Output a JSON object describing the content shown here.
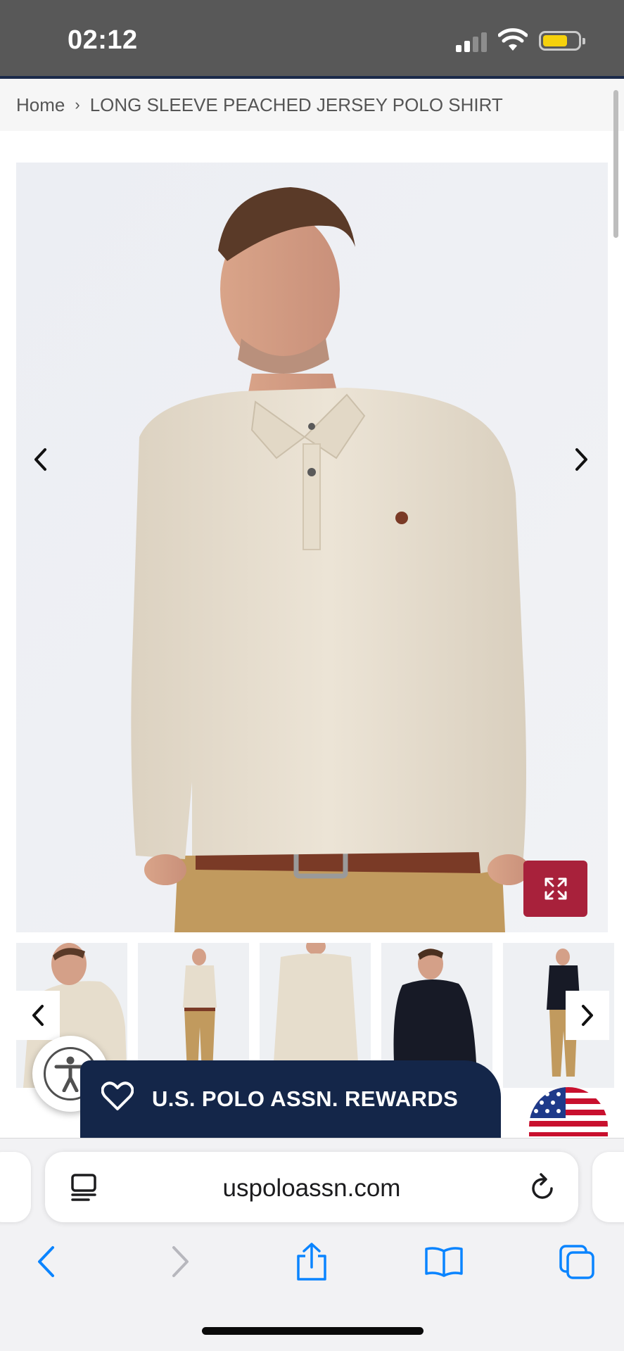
{
  "status_bar": {
    "time": "02:12",
    "icons": [
      "cellular-signal-icon",
      "wifi-icon",
      "battery-icon"
    ],
    "battery_color": "#f5d10c"
  },
  "breadcrumb": {
    "home": "Home",
    "separator": "›",
    "current": "LONG SLEEVE PEACHED JERSEY POLO SHIRT"
  },
  "product_gallery": {
    "main_image": "man wearing long sleeve oatmeal polo shirt with khaki pants and brown belt",
    "prev_icon": "chevron-left-icon",
    "next_icon": "chevron-right-icon",
    "expand_icon": "expand-arrows-icon",
    "expand_color": "#a8213b",
    "thumbnails": [
      "oatmeal polo close-up",
      "oatmeal polo full body",
      "oatmeal polo back view",
      "black polo close-up",
      "black polo full body"
    ]
  },
  "accessibility": {
    "icon": "accessibility-person-icon",
    "close_icon": "close-icon"
  },
  "rewards": {
    "label": "U.S. POLO ASSN. REWARDS",
    "icon": "heart-icon",
    "color": "#142649"
  },
  "region_flag": {
    "icon": "us-flag-icon"
  },
  "browser": {
    "url": "uspoloassn.com",
    "reader_icon": "reader-mode-icon",
    "reload_icon": "reload-icon",
    "toolbar": [
      "back-icon",
      "forward-icon",
      "share-icon",
      "bookmarks-icon",
      "tabs-icon"
    ],
    "accent_color": "#0a84ff"
  }
}
